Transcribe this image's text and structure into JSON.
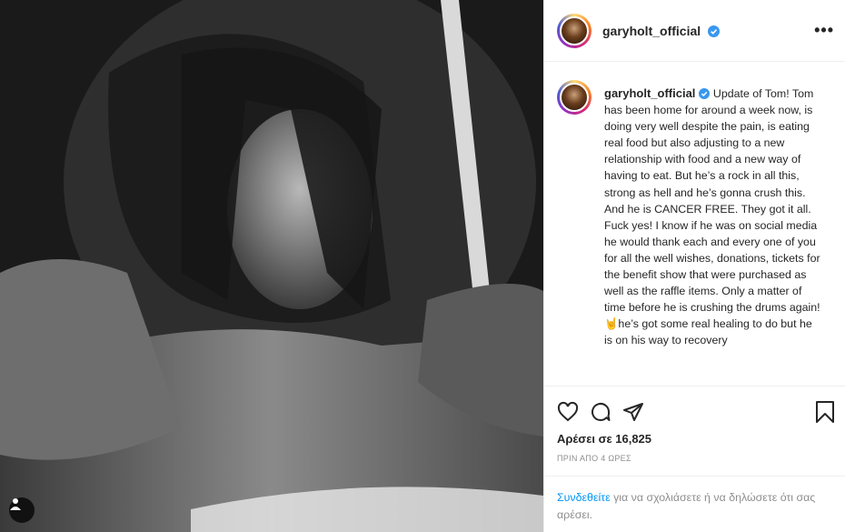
{
  "post": {
    "username": "garyholt_official",
    "caption": "Update of Tom! Tom has been home for around a week now, is doing very well despite the pain, is eating real food but also adjusting to a new relationship with food and a new way of having to eat. But he’s a rock in all this, strong as hell and he’s gonna crush this. And he is CANCER FREE. They got it all. Fuck yes! I know if he was on social media he would thank each and every one of you for all the well wishes, donations, tickets for the benefit show that were purchased as well as the raffle items. Only a matter of time before he is crushing the drums again!🤘he’s got some real healing to do but he is on his way to recovery",
    "likes": "Αρέσει σε 16,825",
    "time": "ΠΡΙΝ ΑΠΟ 4 ΩΡΕΣ",
    "login_link": "Συνδεθείτε",
    "login_text": " για να σχολιάσετε ή να δηλώσετε ότι σας αρέσει."
  },
  "icons": {
    "more": "more-options-icon",
    "like": "heart-icon",
    "comment": "comment-icon",
    "share": "send-icon",
    "save": "bookmark-icon",
    "verified": "verified-badge-icon",
    "tags": "user-tag-icon"
  },
  "colors": {
    "link": "#0095f6",
    "verified": "#3897f0",
    "muted": "#8e8e8e"
  }
}
